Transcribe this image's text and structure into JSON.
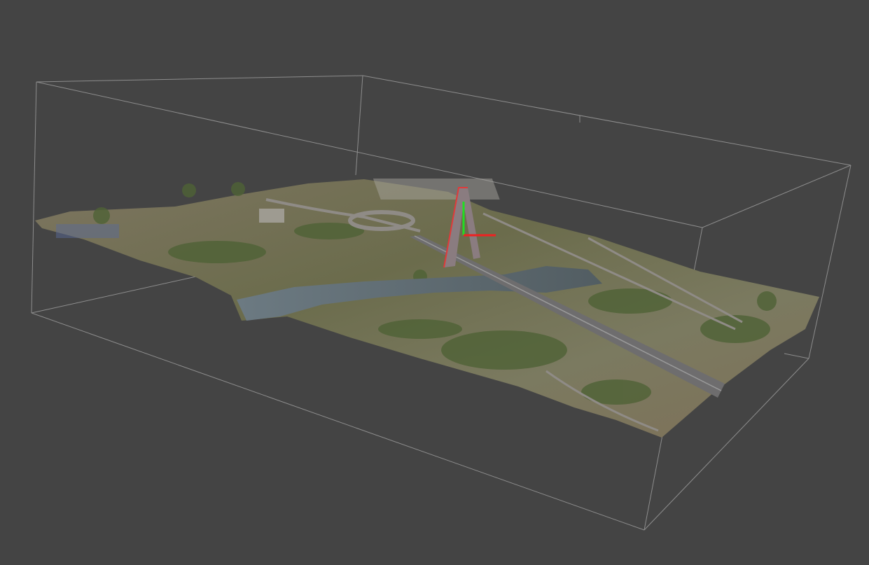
{
  "viewer": {
    "background_color": "#444444",
    "bounding_box_color": "#9a9a9a",
    "gizmo": {
      "y_axis_color": "#22dd22",
      "x_axis_color": "#ee2222",
      "icon": "transform-gizmo-icon"
    },
    "model": {
      "icon": "terrain-mesh-icon",
      "terrain_color": "#6f6a52",
      "vegetation_color": "#4f6236",
      "river_color": "#5d6a72",
      "bridge_color": "#7a7a7c",
      "pylon_color": "#8a7c80",
      "selection_color": "#e03a3a"
    }
  }
}
